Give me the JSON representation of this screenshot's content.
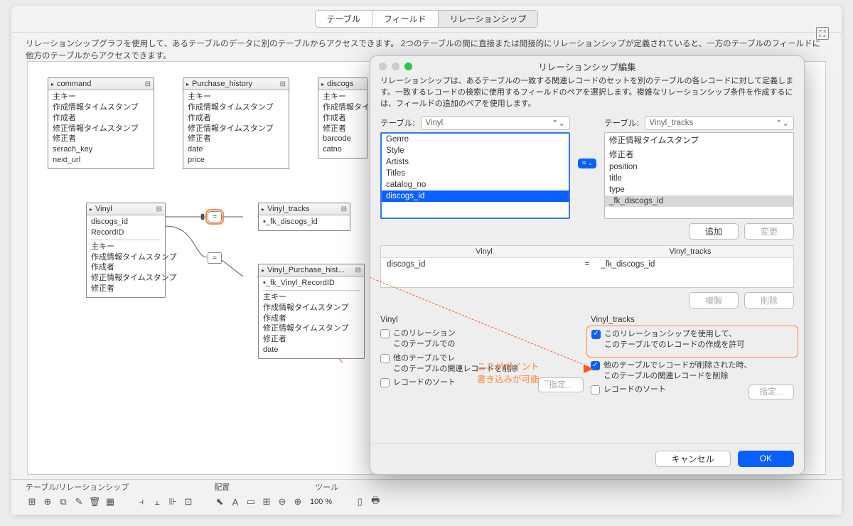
{
  "tabs": {
    "tables": "テーブル",
    "fields": "フィールド",
    "relations": "リレーションシップ"
  },
  "description": "リレーションシップグラフを使用して、あるテーブルのデータに別のテーブルからアクセスできます。 2つのテーブルの間に直接または間接的にリレーションシップが定義されていると、一方のテーブルのフィールドに他方のテーブルからアクセスできます。",
  "graph": {
    "command": {
      "name": "command",
      "fields": [
        "主キー",
        "作成情報タイムスタンプ",
        "作成者",
        "修正情報タイムスタンプ",
        "修正者",
        "serach_key",
        "next_url"
      ]
    },
    "purchase_history": {
      "name": "Purchase_history",
      "fields": [
        "主キー",
        "作成情報タイムスタンプ",
        "作成者",
        "修正情報タイムスタンプ",
        "修正者",
        "date",
        "price"
      ]
    },
    "discogs": {
      "name": "discogs",
      "fields": [
        "主キー",
        "作成情報タイムスタンプ",
        "作成者",
        "修正者",
        "barcode",
        "catno"
      ]
    },
    "vinyl": {
      "name": "Vinyl",
      "key1": "discogs_id",
      "key2": "RecordID",
      "fields": [
        "主キー",
        "作成情報タイムスタンプ",
        "作成者",
        "修正情報タイムスタンプ",
        "修正者"
      ]
    },
    "vinyl_tracks": {
      "name": "Vinyl_tracks",
      "fk": "•_fk_discogs_id"
    },
    "vinyl_purchase": {
      "name": "Vinyl_Purchase_hist...",
      "fk": "•_fk_Vinyl_RecordID",
      "fields": [
        "主キー",
        "作成情報タイムスタンプ",
        "作成者",
        "修正情報タイムスタンプ",
        "修正者",
        "date"
      ]
    }
  },
  "footer": {
    "labels": {
      "l1": "テーブル/リレーションシップ",
      "l2": "配置",
      "l3": "ツール"
    },
    "zoom": "100"
  },
  "modal": {
    "title": "リレーションシップ編集",
    "desc": "リレーションシップは、あるテーブルの一致する関連レコードのセットを別のテーブルの各レコードに対して定義します。一致するレコードの検索に使用するフィールドのペアを選択します。複雑なリレーションシップ条件を作成するには、フィールドの追加のペアを使用します。",
    "table_label": "テーブル:",
    "left_table": "Vinyl",
    "right_table": "Vinyl_tracks",
    "left_fields": [
      "Genre",
      "Style",
      "Artists",
      "Titles",
      "catalog_no",
      "discogs_id"
    ],
    "right_fields": [
      "修正情報タイムスタンプ",
      "修正者",
      "position",
      "title",
      "type",
      "_fk_discogs_id"
    ],
    "op": "=",
    "btn_add": "追加",
    "btn_change": "変更",
    "pair_left_h": "Vinyl",
    "pair_right_h": "Vinyl_tracks",
    "pair_left": "discogs_id",
    "pair_right": "_fk_discogs_id",
    "btn_dup": "複製",
    "btn_del": "削除",
    "perm_left_title": "Vinyl",
    "perm_right_title": "Vinyl_tracks",
    "chk_create_1": "このリレーション",
    "chk_create_2": "このテーブルでの",
    "chk_del_1": "他のテーブルでレ",
    "chk_del_2": "このテーブルの関連レコードを削除",
    "chk_sort": "レコードのソート",
    "btn_spec": "指定...",
    "chk_r_create_1": "このリレーションシップを使用して、",
    "chk_r_create_2": "このテーブルでのレコードの作成を許可",
    "chk_r_del_1": "他のテーブルでレコードが削除された時、",
    "chk_r_del_2": "このテーブルの関連レコードを削除",
    "btn_cancel": "キャンセル",
    "btn_ok": "OK",
    "annot1": "ここがポイント",
    "annot2": "書き込みが可能   →"
  }
}
